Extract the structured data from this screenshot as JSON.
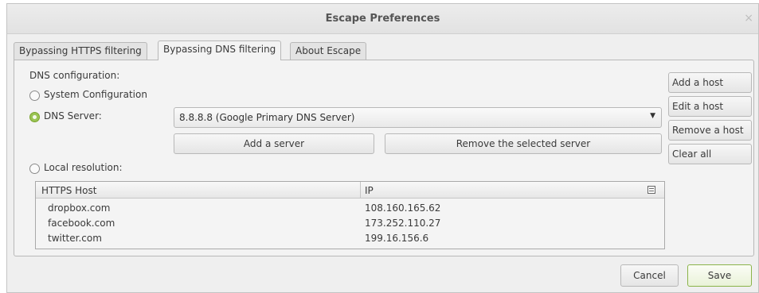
{
  "window": {
    "title": "Escape Preferences",
    "close_glyph": "×"
  },
  "tabs": [
    {
      "label": "Bypassing HTTPS filtering",
      "active": false
    },
    {
      "label": "Bypassing DNS filtering",
      "active": true
    },
    {
      "label": "About Escape",
      "active": false
    }
  ],
  "dns": {
    "heading": "DNS configuration:",
    "system_option": "System Configuration",
    "server_option": "DNS Server:",
    "server_selected": "8.8.8.8 (Google Primary DNS Server)",
    "add_server": "Add a server",
    "remove_server": "Remove the selected server",
    "local_option": "Local resolution:",
    "selected_mode": "DNS Server:"
  },
  "host_buttons": {
    "add": "Add a host",
    "edit": "Edit a host",
    "remove": "Remove a host",
    "clear": "Clear all"
  },
  "table": {
    "columns": [
      "HTTPS Host",
      "IP"
    ],
    "rows": [
      {
        "host": "dropbox.com",
        "ip": "108.160.165.62"
      },
      {
        "host": "facebook.com",
        "ip": "173.252.110.27"
      },
      {
        "host": "twitter.com",
        "ip": "199.16.156.6"
      }
    ]
  },
  "footer": {
    "cancel": "Cancel",
    "save": "Save"
  },
  "colors": {
    "accent_green": "#9ac454",
    "save_border": "#8bb34a"
  },
  "icons": {
    "radio_checked": "radio-checked-icon",
    "dropdown": "dropdown-arrow-icon",
    "column_chooser": "column-chooser-icon"
  }
}
